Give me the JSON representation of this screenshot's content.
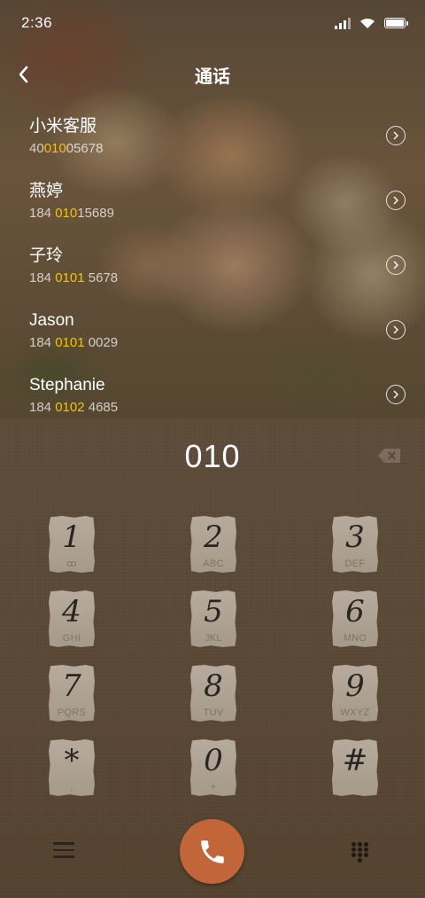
{
  "status_bar": {
    "time": "2:36"
  },
  "header": {
    "title": "通话"
  },
  "contacts": [
    {
      "name": "小米客服",
      "number_pre": "40",
      "number_match": "010",
      "number_post": "05678"
    },
    {
      "name": "燕婷",
      "number_pre": "184 ",
      "number_match": "010",
      "number_post": "15689"
    },
    {
      "name": "子玲",
      "number_pre": "184 ",
      "number_match": "0101",
      "number_post": " 5678"
    },
    {
      "name": "Jason",
      "number_pre": "184 ",
      "number_match": "0101",
      "number_post": " 0029"
    },
    {
      "name": "Stephanie",
      "number_pre": "184 ",
      "number_match": "0102",
      "number_post": " 4685"
    }
  ],
  "dialer": {
    "dialed_number": "010"
  },
  "keypad": [
    {
      "digit": "1",
      "letters": "ꝏ"
    },
    {
      "digit": "2",
      "letters": "ABC"
    },
    {
      "digit": "3",
      "letters": "DEF"
    },
    {
      "digit": "4",
      "letters": "GHI"
    },
    {
      "digit": "5",
      "letters": "JKL"
    },
    {
      "digit": "6",
      "letters": "MNO"
    },
    {
      "digit": "7",
      "letters": "PQRS"
    },
    {
      "digit": "8",
      "letters": "TUV"
    },
    {
      "digit": "9",
      "letters": "WXYZ"
    },
    {
      "digit": "*",
      "letters": ","
    },
    {
      "digit": "0",
      "letters": "+"
    },
    {
      "digit": "#",
      "letters": ""
    }
  ],
  "colors": {
    "highlight": "#f5c400",
    "call_button": "#c2663a"
  },
  "icons": {
    "back": "chevron-left-icon",
    "detail": "chevron-right-circle-icon",
    "backspace": "backspace-icon",
    "menu": "menu-icon",
    "call": "phone-icon",
    "keypad": "dialpad-icon"
  }
}
